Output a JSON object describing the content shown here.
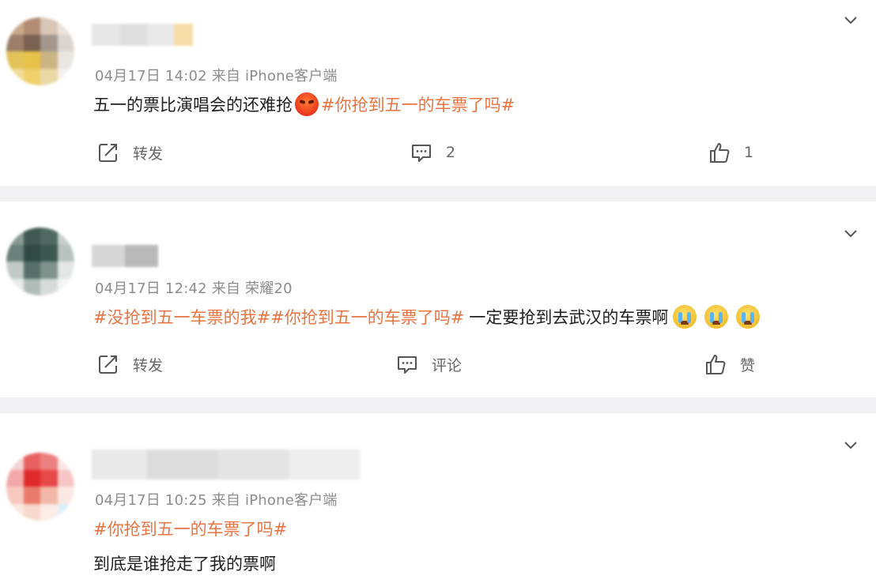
{
  "posts": [
    {
      "meta": "04月17日 14:02 来自 iPhone客户端",
      "content": [
        {
          "type": "text",
          "text": "五一的票比演唱会的还难抢"
        },
        {
          "type": "emoji",
          "icon": "angry-emoji-icon"
        },
        {
          "type": "topic",
          "text": "#你抢到五一的车票了吗#"
        }
      ],
      "actions": {
        "repost": "转发",
        "comment": "2",
        "like": "1"
      }
    },
    {
      "meta": "04月17日 12:42 来自 荣耀20",
      "content": [
        {
          "type": "topic",
          "text": "#没抢到五一车票的我##你抢到五一的车票了吗#"
        },
        {
          "type": "text",
          "text": " 一定要抢到去武汉的车票啊"
        },
        {
          "type": "emoji",
          "icon": "crying-emoji-icon"
        },
        {
          "type": "emoji",
          "icon": "crying-emoji-icon"
        },
        {
          "type": "emoji",
          "icon": "crying-emoji-icon"
        }
      ],
      "actions": {
        "repost": "转发",
        "comment": "评论",
        "like": "赞"
      }
    },
    {
      "meta": "04月17日 10:25 来自 iPhone客户端",
      "topic_line": "#你抢到五一的车票了吗#",
      "text_line": "到底是谁抢走了我的票啊"
    }
  ],
  "colors": {
    "topic": "#eb7340",
    "meta": "#8c8c8c",
    "separator": "#f1f1f3"
  }
}
